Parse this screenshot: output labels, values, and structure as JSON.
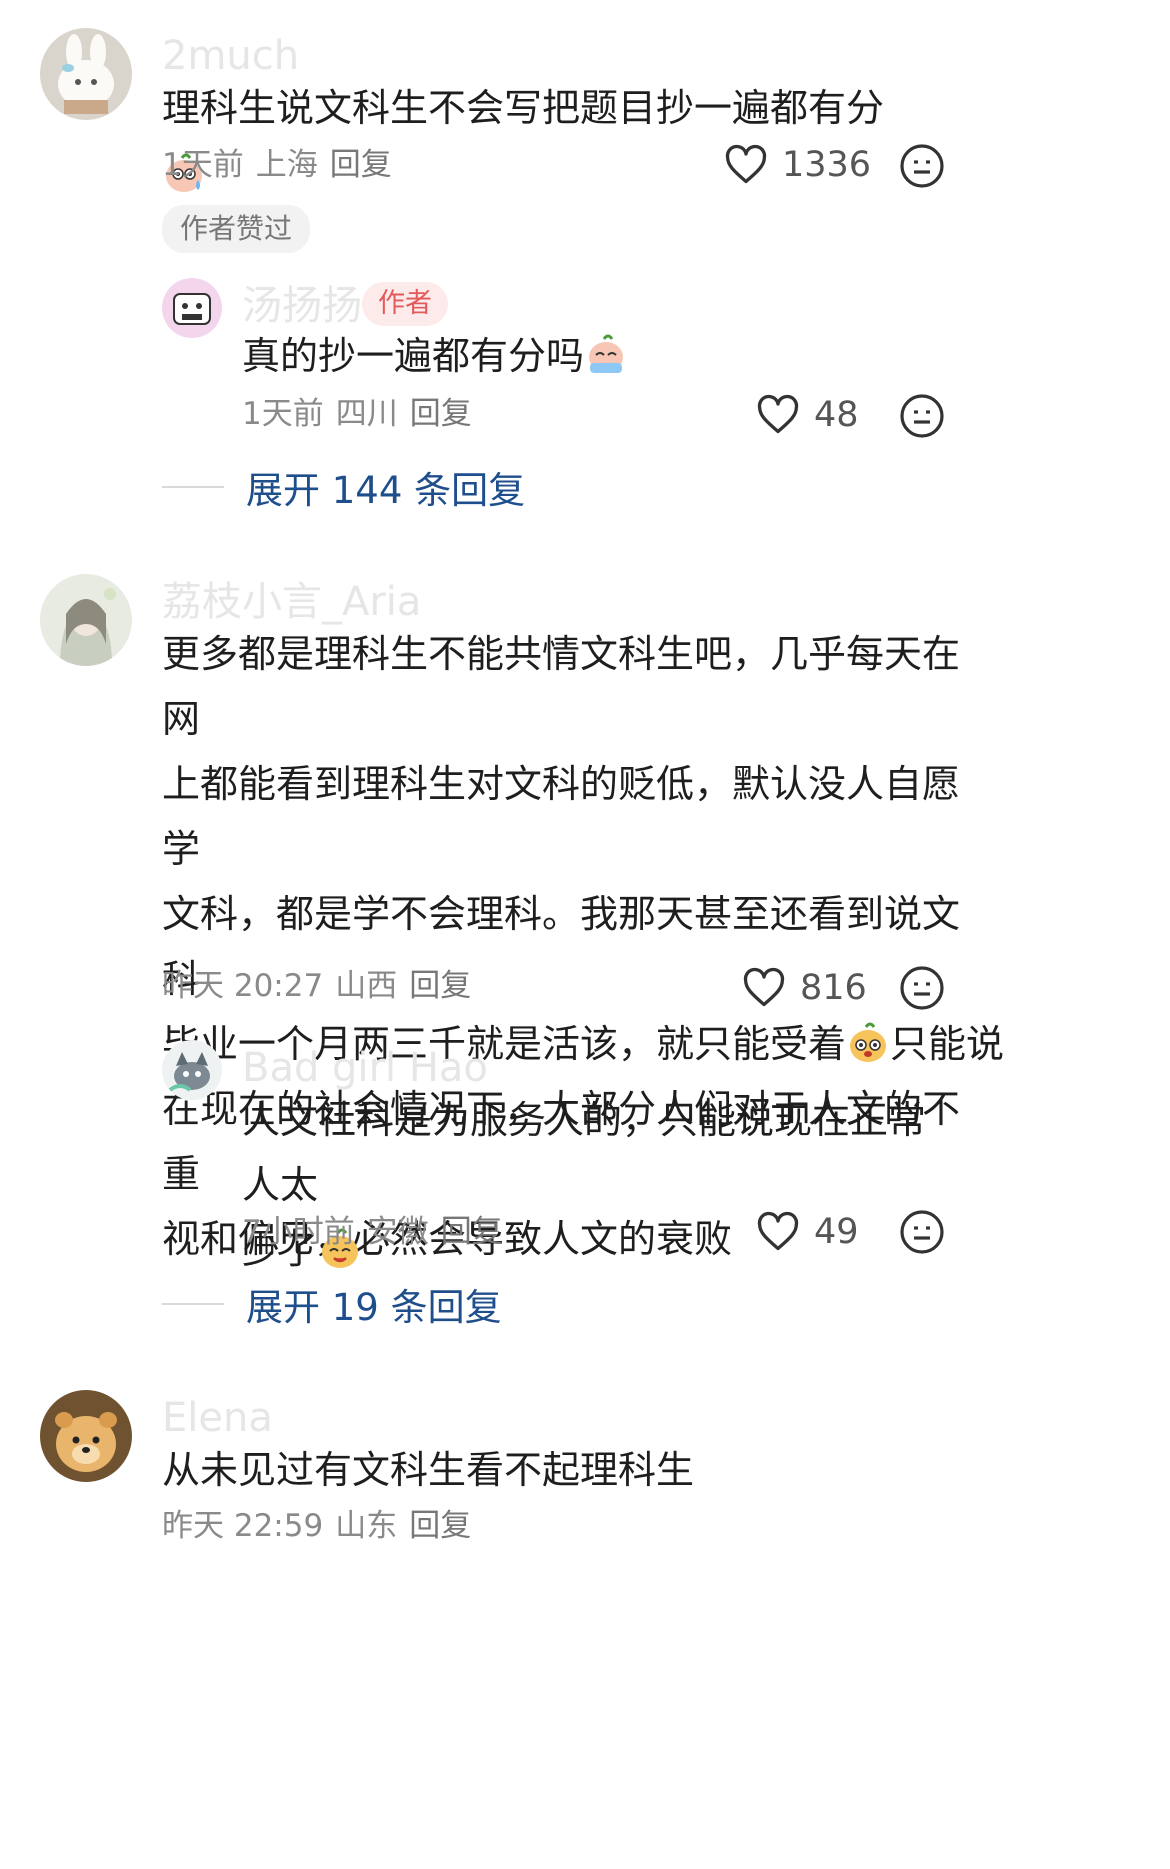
{
  "comments": [
    {
      "username": "2much",
      "text": "理科生说文科生不会写把题目抄一遍都有分",
      "time": "1天前",
      "location": "上海",
      "reply_label": "回复",
      "likes": "1336",
      "badge": "作者赞过",
      "replies": [
        {
          "username": "汤扬扬",
          "author_tag": "作者",
          "text": "真的抄一遍都有分吗",
          "time": "1天前",
          "location": "四川",
          "reply_label": "回复",
          "likes": "48"
        }
      ],
      "expand_label": "展开 144 条回复"
    },
    {
      "username": "荔枝小言_Aria",
      "text_lines": [
        "更多都是理科生不能共情文科生吧，几乎每天在网",
        "上都能看到理科生对文科的贬低，默认没人自愿学",
        "文科，都是学不会理科。我那天甚至还看到说文科",
        "毕业一个月两三千就是活该，就只能受着",
        "只能说",
        "在现在的社会情况下，大部分人们对于人文的不重",
        "视和偏见，必然会导致人文的衰败"
      ],
      "time": "昨天 20:27",
      "location": "山西",
      "reply_label": "回复",
      "likes": "816",
      "replies": [
        {
          "username": "Bad girl Hao",
          "text_line1": "人文社科是为服务人的，只能说现在正常人太",
          "text_line2": "少了",
          "time": "7小时前",
          "location": "安徽",
          "reply_label": "回复",
          "likes": "49"
        }
      ],
      "expand_label": "展开 19 条回复"
    },
    {
      "username": "Elena",
      "text": "从未见过有文科生看不起理科生",
      "time": "昨天 22:59",
      "location": "山东",
      "reply_label": "回复"
    }
  ],
  "icons": {
    "like": "heart-outline-icon",
    "emoji": "neutral-face-icon"
  },
  "colors": {
    "link": "#1f4e8c",
    "author_tag": "#e35a5a",
    "meta": "#8a8a8a"
  }
}
